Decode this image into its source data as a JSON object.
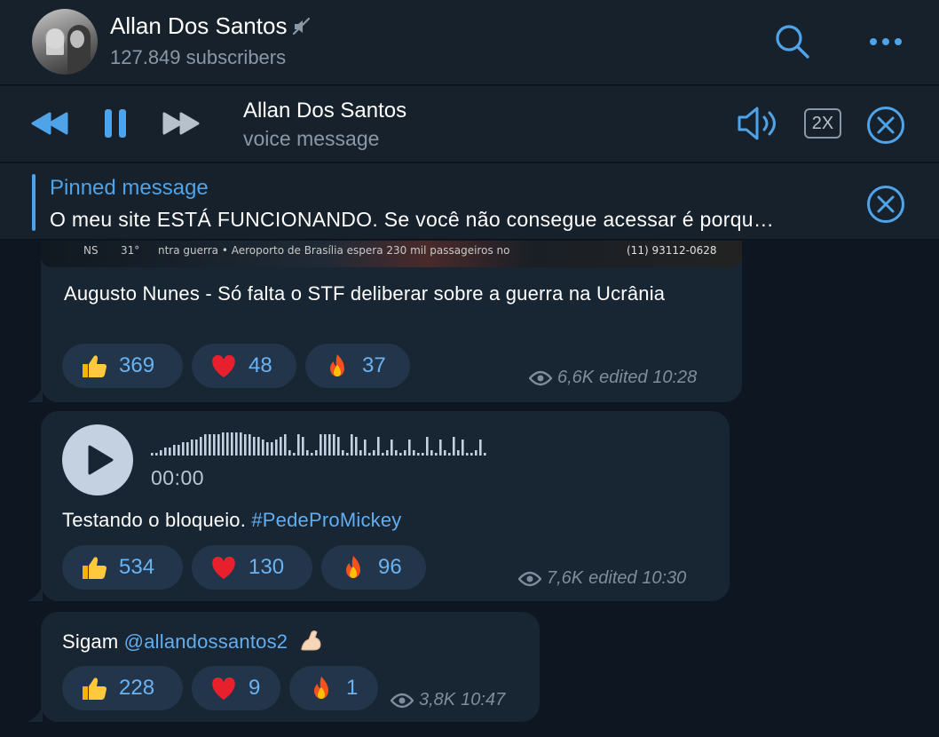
{
  "header": {
    "title": "Allan Dos Santos",
    "subscribers": "127.849 subscribers",
    "mute_icon": "muted-speaker-icon",
    "search_icon": "search-icon",
    "more_icon": "more-dots-icon"
  },
  "player": {
    "title": "Allan Dos Santos",
    "subtitle": "voice message",
    "speed_label": "2X",
    "icons": [
      "rewind-icon",
      "pause-icon",
      "fast-forward-icon",
      "volume-icon",
      "close-icon"
    ]
  },
  "pinned": {
    "title": "Pinned message",
    "text": "O meu site ESTÁ FUNCIONANDO. Se você não consegue acessar é porqu…"
  },
  "media_strip": {
    "ticker_left": "NS",
    "temperature": "31°",
    "ticker_text": "ntra guerra • Aeroporto de Brasília espera 230 mil passageiros no",
    "phone": "(11) 93112-0628"
  },
  "messages": [
    {
      "text": "Augusto Nunes - Só falta o STF deliberar sobre a guerra na Ucrânia",
      "reactions": [
        {
          "emoji": "thumbs-up",
          "count": "369"
        },
        {
          "emoji": "heart",
          "count": "48"
        },
        {
          "emoji": "fire",
          "count": "37"
        }
      ],
      "views": "6,6K",
      "time": "edited 10:28"
    },
    {
      "duration": "00:00",
      "text_plain": "Testando o bloqueio. ",
      "hashtag": "#PedeProMickey",
      "reactions": [
        {
          "emoji": "thumbs-up",
          "count": "534"
        },
        {
          "emoji": "heart",
          "count": "130"
        },
        {
          "emoji": "fire",
          "count": "96"
        }
      ],
      "views": "7,6K",
      "time": "edited 10:30"
    },
    {
      "text_plain": "Sigam ",
      "mention": "@allandossantos2",
      "trailing_emoji": "💪🏻",
      "reactions": [
        {
          "emoji": "thumbs-up",
          "count": "228"
        },
        {
          "emoji": "heart",
          "count": "9"
        },
        {
          "emoji": "fire",
          "count": "1"
        }
      ],
      "views": "3,8K",
      "time": "10:47"
    }
  ],
  "colors": {
    "background": "#0e1621",
    "panel": "#17212b",
    "bubble": "#182533",
    "reaction": "#22354a",
    "accent": "#4fa3e8",
    "muted_text": "#8a98a6"
  }
}
